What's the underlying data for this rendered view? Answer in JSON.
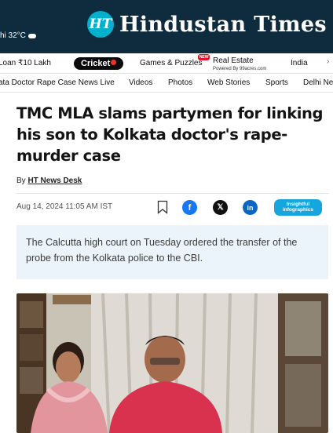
{
  "header": {
    "weather": "hi 32°C",
    "logo_mark": "HT",
    "brand": "Hindustan Times"
  },
  "nav_primary": {
    "loan": "Loan ₹10 Lakh",
    "cricket": "Cricket",
    "games": "Games & Puzzles",
    "new_badge": "NEW",
    "real_estate": "Real Estate",
    "powered_by": "Powered By 99acres.com",
    "india": "India"
  },
  "nav_secondary": [
    "ata Doctor Rape Case News Live",
    "Videos",
    "Photos",
    "Web Stories",
    "Sports",
    "Delhi Ne"
  ],
  "article": {
    "headline": "TMC MLA slams partymen for linking his son to Kolkata doctor's rape-murder case",
    "by_prefix": "By ",
    "author": "HT News Desk",
    "date": "Aug 14, 2024 11:05 AM IST",
    "summary": "The Calcutta high court on Tuesday ordered the transfer of the probe from the Kolkata police to the CBI.",
    "insight_badge_line1": "Insightful",
    "insight_badge_line2": "infographics"
  },
  "social": {
    "facebook": "f",
    "x": "𝕏",
    "linkedin": "in"
  },
  "colors": {
    "header_bg": "#0f2c3f",
    "logo_accent": "#00b1cd",
    "summary_bg": "#eaf4fa",
    "insight_badge": "#14a6dd"
  }
}
